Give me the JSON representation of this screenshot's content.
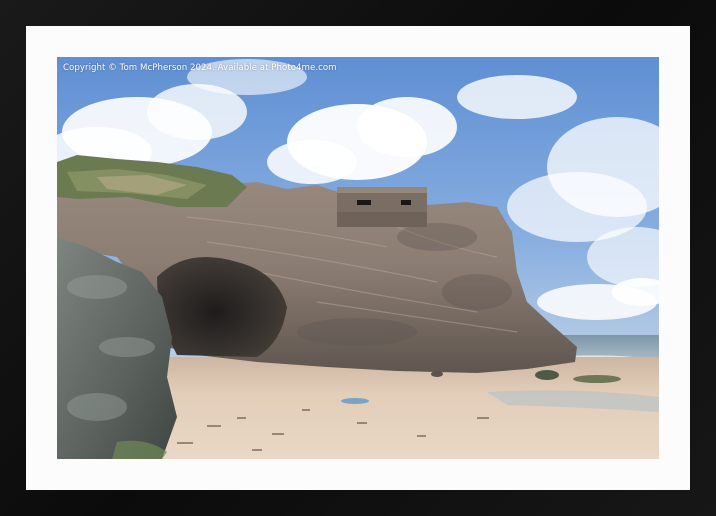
{
  "watermark": {
    "text": "Copyright © Tom McPherson 2024. Available at Photo4me.com"
  },
  "scene": {
    "subjects": [
      "wartime-pillbox",
      "sea-cliff",
      "sea-cave",
      "sandy-beach",
      "sea",
      "clouds"
    ]
  },
  "colors": {
    "frame": "#111111",
    "mount": "#fcfcfc",
    "sky": "#6f9bd6",
    "rock": "#8a7b70",
    "sand": "#e3cdb7",
    "sea": "#c9d7de"
  }
}
